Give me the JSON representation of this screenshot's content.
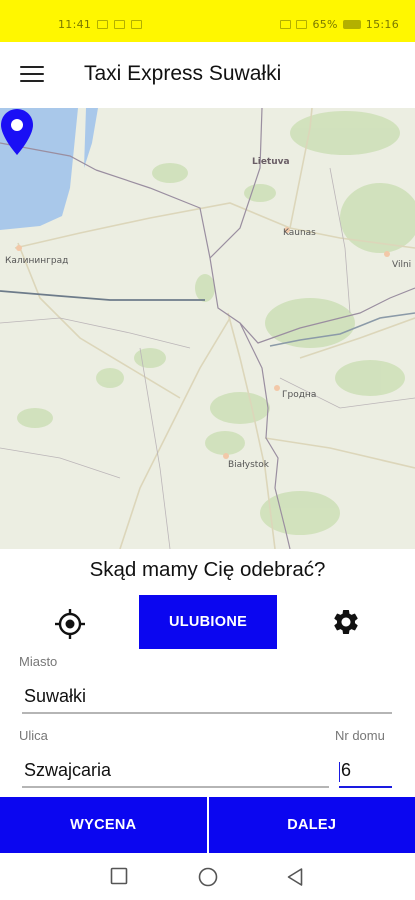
{
  "status_bar": {
    "left_text": "11:41",
    "right_battery": "65%",
    "right_time": "15:16"
  },
  "app": {
    "title": "Taxi Express Suwałki"
  },
  "map": {
    "labels": {
      "lithuania": "Lietuva",
      "kaunas": "Kaunas",
      "vilnius": "Vilni",
      "kaliningrad": "Калининград",
      "grodno": "Гродна",
      "bialystok": "Białystok"
    }
  },
  "form": {
    "prompt": "Skąd mamy Cię odebrać?",
    "favorites_label": "ULUBIONE",
    "city_label": "Miasto",
    "city_value": "Suwałki",
    "street_label": "Ulica",
    "street_value": "Szwajcaria",
    "house_label": "Nr domu",
    "house_value": "6"
  },
  "actions": {
    "quote_label": "WYCENA",
    "next_label": "DALEJ"
  },
  "colors": {
    "status_bar": "#fff700",
    "primary_button": "#0b06f0",
    "pin": "#1a0ff5"
  }
}
